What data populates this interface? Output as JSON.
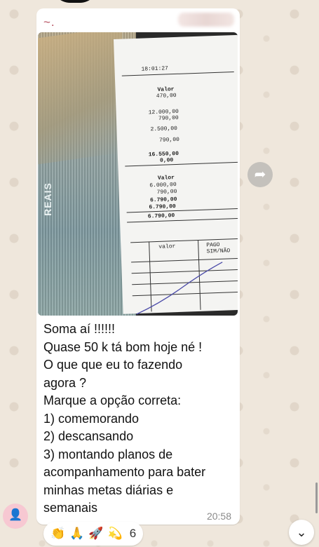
{
  "chat": {
    "sender": "~.",
    "time": "20:58",
    "message_lines": [
      "Soma aí !!!!!!",
      "Quase 50 k tá bom hoje né !",
      "O que que eu to fazendo",
      "agora ?",
      "Marque a opção  correta:",
      "1) comemorando",
      "2) descansando",
      "3) montando planos de",
      "acompanhamento para bater",
      "minhas metas diárias e",
      "semanais"
    ]
  },
  "photo": {
    "banknote_text": "REAIS",
    "receipt": {
      "time": "18:01:27",
      "header1": "Valor",
      "v1": "470,00",
      "v2": "12.000,00",
      "v3": "790,00",
      "v4": "2.500,00",
      "v5": "790,00",
      "v6": "16.550,00",
      "v7": "0,00",
      "header2": "Valor",
      "w1": "6.000,00",
      "w2": "790,00",
      "w3": "6.790,00",
      "w4": "6.790,00",
      "w5": "6.790,00",
      "col_valor": "valor",
      "col_pago": "PAGO",
      "col_simnao": "SIM/NÃO"
    }
  },
  "reactions": {
    "emojis": [
      "👏",
      "🙏",
      "🚀",
      "💫"
    ],
    "count": "6"
  },
  "icons": {
    "forward": "forward-icon",
    "scroll": "chevron-down-icon",
    "avatar": "person-icon"
  }
}
